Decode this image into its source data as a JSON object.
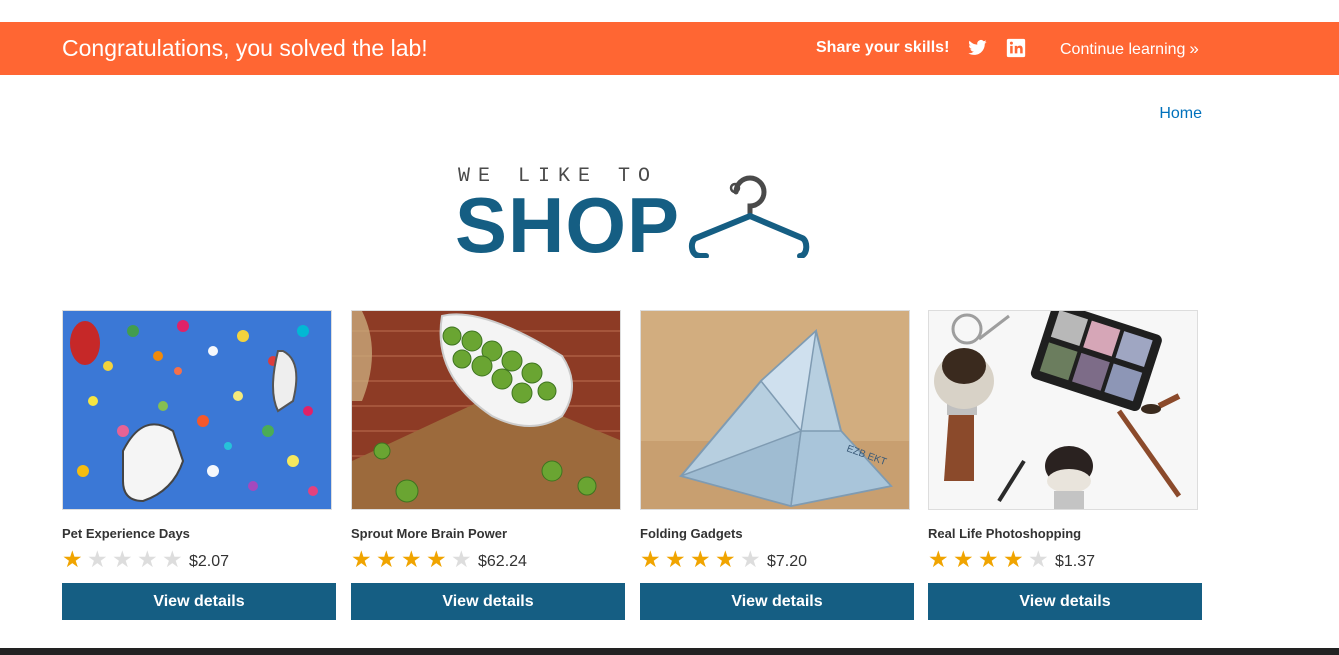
{
  "banner": {
    "title": "Congratulations, you solved the lab!",
    "share_label": "Share your skills!",
    "continue_label": "Continue learning",
    "continue_icon": "»",
    "color": "#ff6633"
  },
  "nav": {
    "home_label": "Home"
  },
  "logo": {
    "top_text": "WE LIKE TO",
    "main_text": "SHOP"
  },
  "colors": {
    "primary": "#155e83",
    "star": "#f0a400",
    "link": "#0071bc"
  },
  "products": [
    {
      "name": "Pet Experience Days",
      "rating": 1,
      "price": "$2.07",
      "button_label": "View details"
    },
    {
      "name": "Sprout More Brain Power",
      "rating": 4,
      "price": "$62.24",
      "button_label": "View details"
    },
    {
      "name": "Folding Gadgets",
      "rating": 4,
      "price": "$7.20",
      "button_label": "View details"
    },
    {
      "name": "Real Life Photoshopping",
      "rating": 4,
      "price": "$1.37",
      "button_label": "View details"
    }
  ]
}
